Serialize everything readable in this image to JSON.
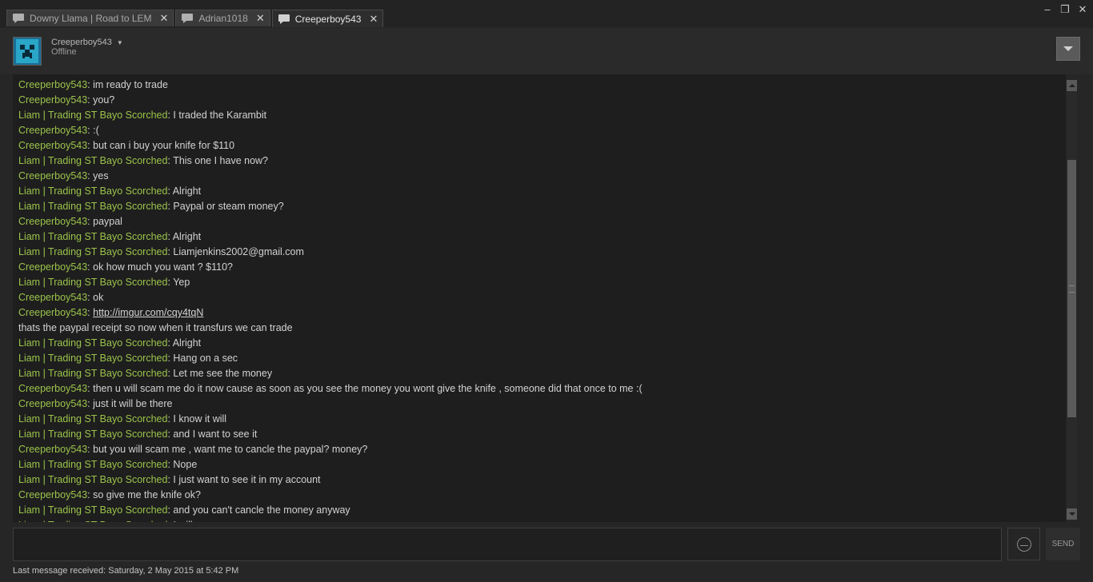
{
  "tabs": [
    {
      "label": "Downy Llama | Road to LEM",
      "icon": "chat-bubble-icon",
      "close": "✕",
      "active": false
    },
    {
      "label": "Adrian1018",
      "icon": "chat-bubble-icon",
      "close": "✕",
      "active": false
    },
    {
      "label": "Creeperboy543",
      "icon": "chat-bubble-icon",
      "close": "✕",
      "active": true
    }
  ],
  "window_controls": {
    "minimize": "–",
    "restore": "❐",
    "close": "✕"
  },
  "friend": {
    "name": "Creeperboy543",
    "status": "Offline",
    "avatar_icon": "creeper-avatar-icon"
  },
  "colors": {
    "friend_name": "#9bc34a",
    "message_text": "#d2d2d2",
    "background": "#1e1e1e"
  },
  "messages": [
    {
      "who": "Creeperboy543",
      "text": "im ready to trade"
    },
    {
      "who": "Creeperboy543",
      "text": "you?"
    },
    {
      "who": "Liam | Trading ST Bayo Scorched",
      "text": "I traded the Karambit"
    },
    {
      "who": "Creeperboy543",
      "text": ":("
    },
    {
      "who": "Creeperboy543",
      "text": "but can i buy your knife for $110"
    },
    {
      "who": "Liam | Trading ST Bayo Scorched",
      "text": "This one I have now?"
    },
    {
      "who": "Creeperboy543",
      "text": "yes"
    },
    {
      "who": "Liam | Trading ST Bayo Scorched",
      "text": "Alright"
    },
    {
      "who": "Liam | Trading ST Bayo Scorched",
      "text": "Paypal or steam money?"
    },
    {
      "who": "Creeperboy543",
      "text": "paypal"
    },
    {
      "who": "Liam | Trading ST Bayo Scorched",
      "text": "Alright"
    },
    {
      "who": "Liam | Trading ST Bayo Scorched",
      "text": "Liamjenkins2002@gmail.com"
    },
    {
      "who": "Creeperboy543",
      "text": "ok how much you want ? $110?"
    },
    {
      "who": "Liam | Trading ST Bayo Scorched",
      "text": "Yep"
    },
    {
      "who": "Creeperboy543",
      "text": "ok"
    },
    {
      "who": "Creeperboy543",
      "text": "",
      "link": "http://imgur.com/cqy4tqN"
    },
    {
      "who": "",
      "text": "thats the paypal receipt so now when it transfurs we can trade"
    },
    {
      "who": "Liam | Trading ST Bayo Scorched",
      "text": "Alright"
    },
    {
      "who": "Liam | Trading ST Bayo Scorched",
      "text": "Hang on a sec"
    },
    {
      "who": "Liam | Trading ST Bayo Scorched",
      "text": "Let me see the money"
    },
    {
      "who": "Creeperboy543",
      "text": "then u will scam me do it now cause as soon as you see the money you wont give the knife , someone did that once to me :("
    },
    {
      "who": "Creeperboy543",
      "text": "just it will be there"
    },
    {
      "who": "Liam | Trading ST Bayo Scorched",
      "text": "I know it will"
    },
    {
      "who": "Liam | Trading ST Bayo Scorched",
      "text": "and I want to see it"
    },
    {
      "who": "Creeperboy543",
      "text": "but you will scam me , want me to cancle the paypal? money?"
    },
    {
      "who": "Liam | Trading ST Bayo Scorched",
      "text": "Nope"
    },
    {
      "who": "Liam | Trading ST Bayo Scorched",
      "text": "I just want to see it in my account"
    },
    {
      "who": "Creeperboy543",
      "text": "so give me the knife ok?"
    },
    {
      "who": "Liam | Trading ST Bayo Scorched",
      "text": "and you can't cancle the money anyway"
    },
    {
      "who": "Liam | Trading ST Bayo Scorched",
      "text": "I will"
    }
  ],
  "input": {
    "value": "",
    "send_label": "SEND",
    "emoticon_icon": "emoticon-icon"
  },
  "footer": {
    "last_message": "Last message received: Saturday, 2 May 2015 at 5:42 PM"
  }
}
